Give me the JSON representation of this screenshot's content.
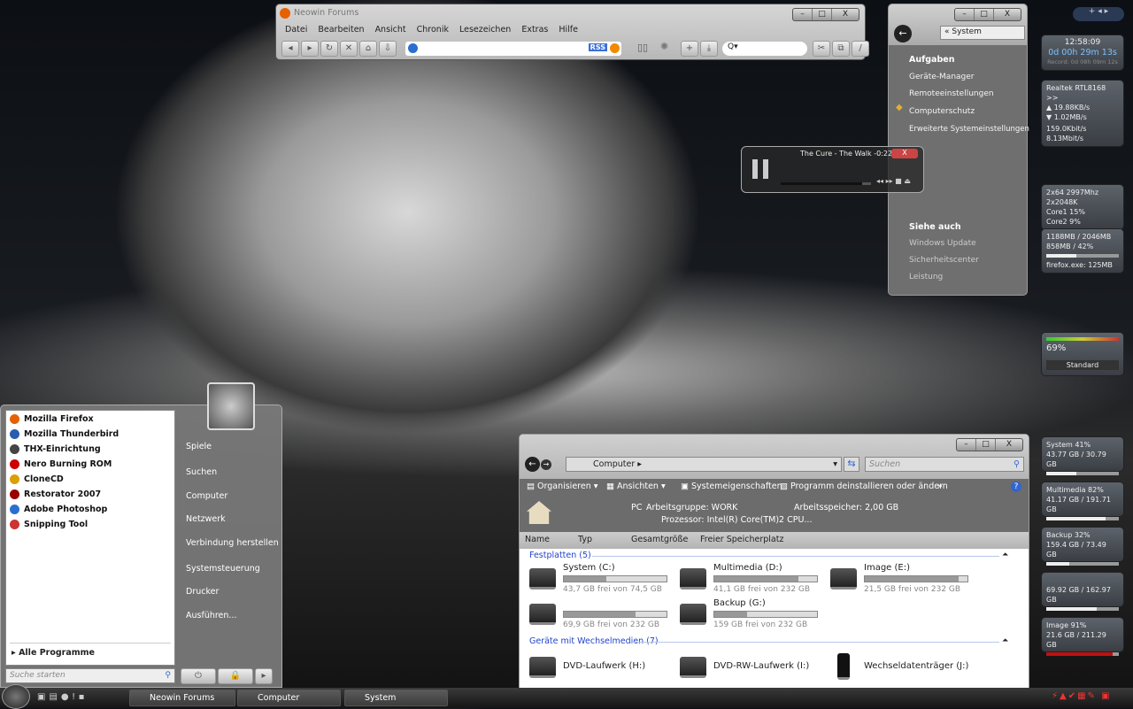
{
  "firefox": {
    "title": "Neowin Forums",
    "menu": [
      "Datei",
      "Bearbeiten",
      "Ansicht",
      "Chronik",
      "Lesezeichen",
      "Extras",
      "Hilfe"
    ],
    "url": "",
    "rss": "RSS",
    "search_placeholder": "Q"
  },
  "system_window": {
    "breadcrumb": "System",
    "tasks_heading": "Aufgaben",
    "tasks": [
      "Geräte-Manager",
      "Remoteeinstellungen",
      "Computerschutz",
      "Erweiterte Systemeinstellungen"
    ],
    "see_also_heading": "Siehe auch",
    "see_also": [
      "Windows Update",
      "Sicherheitscenter",
      "Leistung"
    ]
  },
  "media_player": {
    "track": "The Cure - The Walk -0:22",
    "progress": 0.9
  },
  "explorer": {
    "breadcrumb": "Computer",
    "search_placeholder": "Suchen",
    "toolbar": [
      "Organisieren",
      "Ansichten",
      "Systemeigenschaften",
      "Programm deinstallieren oder ändern"
    ],
    "details": {
      "pc": "PC",
      "workgroup": "Arbeitsgruppe: WORK",
      "memory": "Arbeitsspeicher: 2,00 GB",
      "cpu": "Prozessor: Intel(R) Core(TM)2 CPU..."
    },
    "columns": [
      "Name",
      "Typ",
      "Gesamtgröße",
      "Freier Speicherplatz"
    ],
    "group_hdd": "Festplatten (5)",
    "drives": [
      {
        "name": "System (C:)",
        "free": "43,7 GB frei von 74,5 GB",
        "used": 0.41
      },
      {
        "name": "Multimedia (D:)",
        "free": "41,1 GB frei von 232 GB",
        "used": 0.82
      },
      {
        "name": "Image (E:)",
        "free": "21,5 GB frei von 232 GB",
        "used": 0.91
      },
      {
        "name": "",
        "free": "69,9 GB frei von 232 GB",
        "used": 0.7
      },
      {
        "name": "Backup (G:)",
        "free": "159 GB frei von 232 GB",
        "used": 0.32
      }
    ],
    "group_removable": "Geräte mit Wechselmedien (7)",
    "removable": [
      "DVD-Laufwerk (H:)",
      "DVD-RW-Laufwerk (I:)",
      "Wechseldatenträger (J:)"
    ]
  },
  "start_menu": {
    "programs": [
      {
        "name": "Mozilla Firefox",
        "color": "#e66000"
      },
      {
        "name": "Mozilla Thunderbird",
        "color": "#2a5db0"
      },
      {
        "name": "THX-Einrichtung",
        "color": "#444"
      },
      {
        "name": "Nero Burning ROM",
        "color": "#c00"
      },
      {
        "name": "CloneCD",
        "color": "#d8a000"
      },
      {
        "name": "Restorator 2007",
        "color": "#900"
      },
      {
        "name": "Adobe Photoshop",
        "color": "#2a6fd0"
      },
      {
        "name": "Snipping Tool",
        "color": "#c33"
      }
    ],
    "all_programs": "Alle Programme",
    "search_placeholder": "Suche starten",
    "right": [
      "Spiele",
      "Suchen",
      "Computer",
      "Netzwerk",
      "Verbindung herstellen",
      "Systemsteuerung",
      "Drucker",
      "Ausführen..."
    ]
  },
  "taskbar": {
    "tasks": [
      "Neowin Forums",
      "Computer",
      "System"
    ]
  },
  "gadgets": {
    "clock": {
      "time": "12:58:09",
      "uptime": "0d 00h 29m 13s",
      "record": "Record: 0d 08h 09m 12s"
    },
    "network": {
      "adapter": "Realtek RTL8168 >>",
      "up": "19.88KB/s",
      "down": "1.02MB/s",
      "totals": "159.0Kbit/s   8.13Mbit/s"
    },
    "cpu": {
      "title": "2x64 2997Mhz 2x2048K",
      "cores": [
        {
          "name": "Core1",
          "value": "15%",
          "pct": 15
        },
        {
          "name": "Core2",
          "value": "9%",
          "pct": 9
        }
      ]
    },
    "memory": {
      "line1": "1188MB / 2046MB",
      "line2": "858MB / 42%",
      "pct": 42,
      "process": "firefox.exe: 125MB"
    },
    "volume": {
      "level": "69%",
      "preset": "Standard"
    },
    "drives": [
      {
        "title": "System  41%",
        "size": "43.77 GB / 30.79 GB",
        "pct": 41
      },
      {
        "title": "Multimedia  82%",
        "size": "41.17 GB / 191.71 GB",
        "pct": 82
      },
      {
        "title": "Backup  32%",
        "size": "159.4 GB / 73.49 GB",
        "pct": 32
      },
      {
        "title": "",
        "size": "69.92 GB / 162.97 GB",
        "pct": 70
      },
      {
        "title": "Image  91%",
        "size": "21.6 GB / 211.29 GB",
        "pct": 91,
        "color": "#c01010"
      }
    ]
  }
}
